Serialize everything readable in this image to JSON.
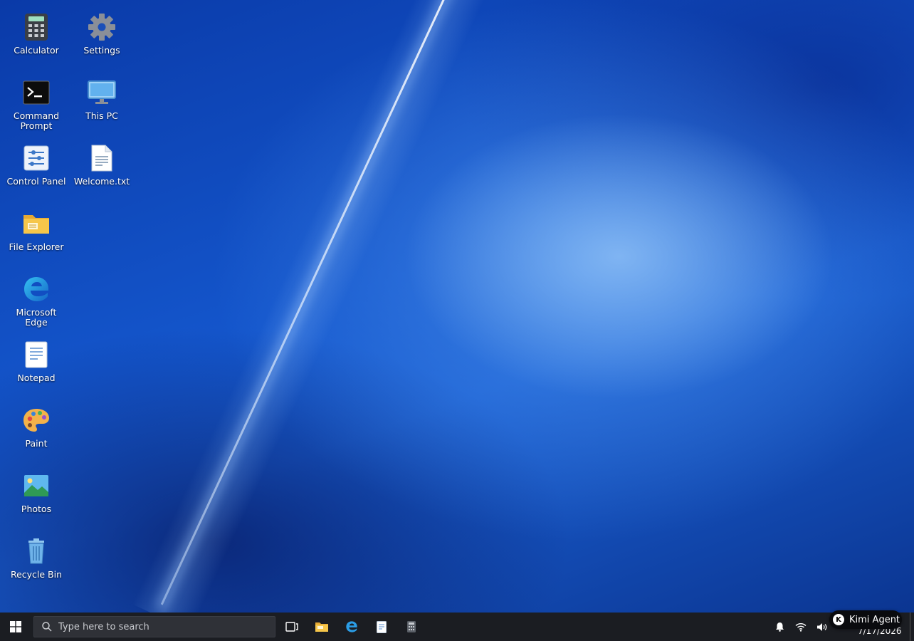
{
  "desktop": {
    "icons": [
      {
        "label": "Calculator",
        "icon": "calculator-icon"
      },
      {
        "label": "Settings",
        "icon": "gear-icon"
      },
      {
        "label": "Command Prompt",
        "icon": "terminal-icon"
      },
      {
        "label": "This PC",
        "icon": "monitor-icon"
      },
      {
        "label": "Control Panel",
        "icon": "control-panel-icon"
      },
      {
        "label": "Welcome.txt",
        "icon": "text-file-icon"
      },
      {
        "label": "File Explorer",
        "icon": "folder-icon"
      },
      {
        "label": "Microsoft Edge",
        "icon": "edge-icon"
      },
      {
        "label": "Notepad",
        "icon": "notepad-icon"
      },
      {
        "label": "Paint",
        "icon": "palette-icon"
      },
      {
        "label": "Photos",
        "icon": "photo-icon"
      },
      {
        "label": "Recycle Bin",
        "icon": "recycle-bin-icon"
      }
    ]
  },
  "taskbar": {
    "search_placeholder": "Type here to search",
    "pinned": [
      "task-view-icon",
      "folder-icon",
      "edge-icon",
      "notepad-icon",
      "calculator-icon"
    ],
    "tray": [
      "bell-icon",
      "wifi-icon",
      "volume-icon"
    ],
    "date": "7/17/2026",
    "agent_label": "Kimi Agent",
    "agent_badge": "K"
  }
}
